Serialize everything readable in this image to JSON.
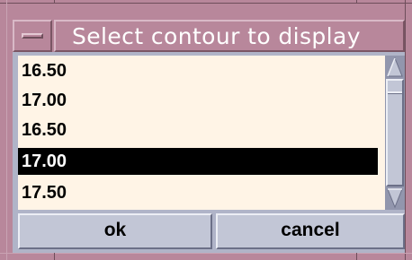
{
  "window": {
    "title": "Select contour to display",
    "menu_icon": "window-menu-icon",
    "frame_color": "#b8879b"
  },
  "list": {
    "items": [
      {
        "label": "16.50",
        "selected": false
      },
      {
        "label": "17.00",
        "selected": false
      },
      {
        "label": "16.50",
        "selected": false
      },
      {
        "label": "17.00",
        "selected": true
      },
      {
        "label": "17.50",
        "selected": false
      }
    ],
    "background": "#fff4e6",
    "selection_color": "#000000"
  },
  "scrollbar": {
    "up_icon": "scroll-up-arrow-icon",
    "down_icon": "scroll-down-arrow-icon"
  },
  "buttons": {
    "ok_label": "ok",
    "cancel_label": "cancel"
  }
}
